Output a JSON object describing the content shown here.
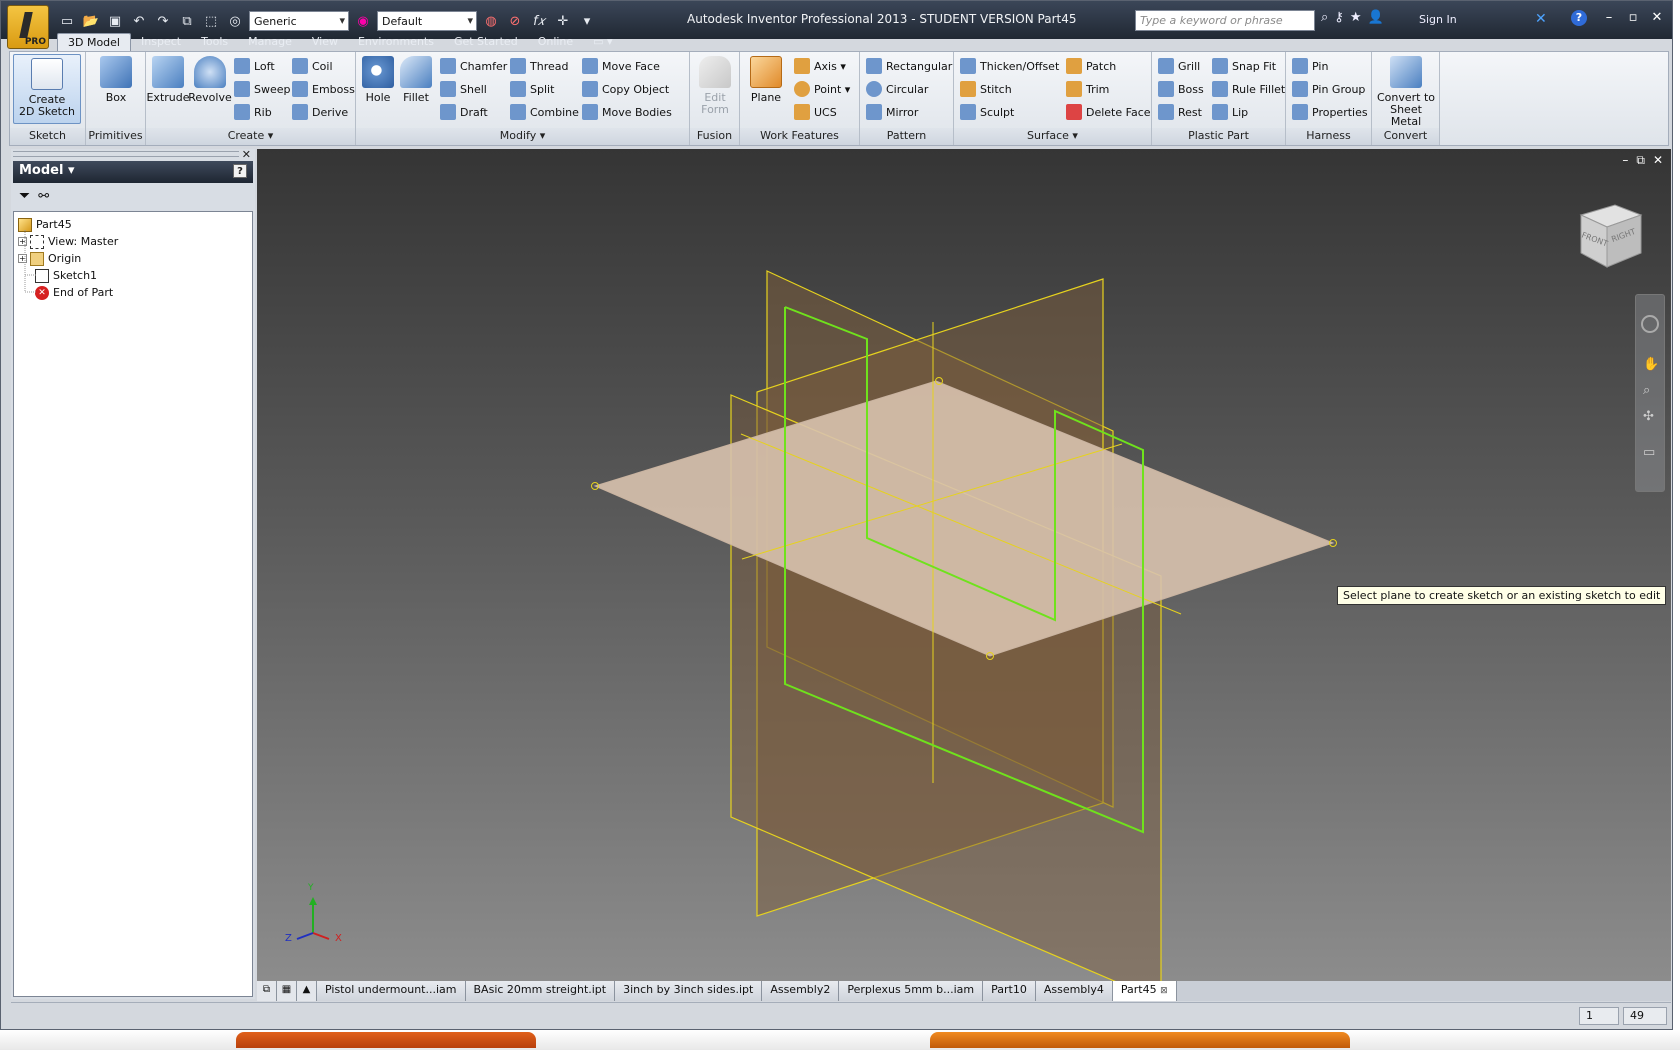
{
  "window": {
    "title": "Autodesk Inventor Professional 2013 - STUDENT VERSION   Part45",
    "app_badge": "PRO",
    "search_placeholder": "Type a keyword or phrase",
    "sign_in": "Sign In"
  },
  "quick_access": {
    "material": "Generic",
    "appearance": "Default"
  },
  "ribbon_tabs": [
    "3D Model",
    "Inspect",
    "Tools",
    "Manage",
    "View",
    "Environments",
    "Get Started",
    "Online"
  ],
  "ribbon": {
    "sketch": {
      "label": "Sketch",
      "create_2d_sketch": "Create\n2D Sketch"
    },
    "primitives": {
      "label": "Primitives",
      "box": "Box"
    },
    "create": {
      "label": "Create",
      "extrude": "Extrude",
      "revolve": "Revolve",
      "loft": "Loft",
      "sweep": "Sweep",
      "rib": "Rib",
      "coil": "Coil",
      "emboss": "Emboss",
      "derive": "Derive"
    },
    "modify": {
      "label": "Modify",
      "hole": "Hole",
      "fillet": "Fillet",
      "chamfer": "Chamfer",
      "shell": "Shell",
      "draft": "Draft",
      "thread": "Thread",
      "split": "Split",
      "combine": "Combine",
      "move_face": "Move Face",
      "copy_object": "Copy Object",
      "move_bodies": "Move Bodies"
    },
    "fusion": {
      "label": "Fusion",
      "edit_form": "Edit\nForm"
    },
    "work_features": {
      "label": "Work Features",
      "plane": "Plane",
      "axis": "Axis",
      "point": "Point",
      "ucs": "UCS"
    },
    "pattern": {
      "label": "Pattern",
      "rectangular": "Rectangular",
      "circular": "Circular",
      "mirror": "Mirror"
    },
    "surface": {
      "label": "Surface",
      "thicken_offset": "Thicken/Offset",
      "stitch": "Stitch",
      "sculpt": "Sculpt",
      "patch": "Patch",
      "trim": "Trim",
      "delete_face": "Delete Face"
    },
    "plastic_part": {
      "label": "Plastic Part",
      "grill": "Grill",
      "boss": "Boss",
      "rest": "Rest",
      "snap_fit": "Snap Fit",
      "rule_fillet": "Rule Fillet",
      "lip": "Lip"
    },
    "harness": {
      "label": "Harness",
      "pin": "Pin",
      "pin_group": "Pin Group",
      "properties": "Properties"
    },
    "convert": {
      "label": "Convert",
      "convert_to_sheet_metal": "Convert to\nSheet Metal"
    }
  },
  "browser": {
    "title": "Model",
    "help": "?",
    "tree": [
      {
        "label": "Part45",
        "icon": "part-icon"
      },
      {
        "label": "View: Master",
        "icon": "view-icon"
      },
      {
        "label": "Origin",
        "icon": "folder-icon"
      },
      {
        "label": "Sketch1",
        "icon": "sketch-icon"
      },
      {
        "label": "End of Part",
        "icon": "end-of-part-icon"
      }
    ]
  },
  "viewport": {
    "tooltip": "Select plane to create sketch or an existing sketch to edit",
    "viewcube_front": "FRONT",
    "viewcube_right": "RIGHT",
    "triad": {
      "x": "X",
      "y": "Y",
      "z": "Z"
    }
  },
  "doc_tabs": [
    "Pistol undermount...iam",
    "BAsic 20mm streight.ipt",
    "3inch by 3inch sides.ipt",
    "Assembly2",
    "Perplexus 5mm b...iam",
    "Part10",
    "Assembly4",
    "Part45"
  ],
  "status": {
    "field1": "1",
    "field2": "49"
  },
  "colors": {
    "plane_edge": "#e6d21e",
    "sketch_green": "#6fe21c",
    "plane_fill": "#8a6a45",
    "horizontal_plane": "#c9b3a0"
  }
}
